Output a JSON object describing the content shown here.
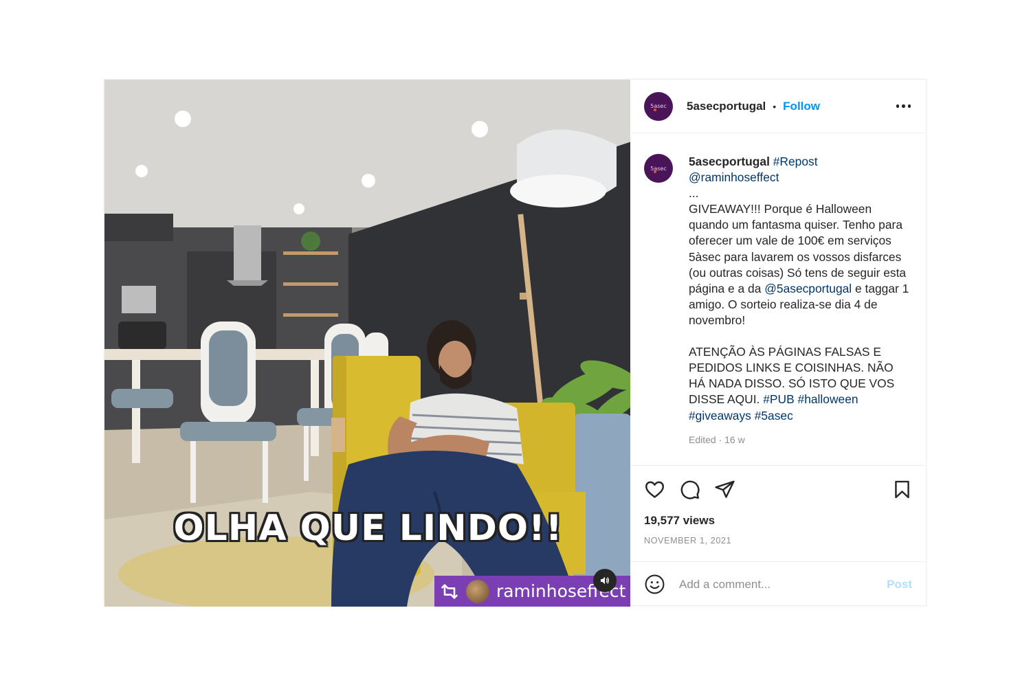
{
  "post": {
    "account": "5asecportugal",
    "separator": "•",
    "follow_label": "Follow",
    "avatar_logo_text": "5asec",
    "media": {
      "overlay_text": "OLHA QUE LINDO!!",
      "repost_username": "raminhoseffect"
    },
    "caption": {
      "username": "5asecportugal",
      "hashtag_repost": "#Repost",
      "mention_source": "@raminhoseffect",
      "ellipsis": "...",
      "text_1": "GIVEAWAY!!! Porque é Halloween quando um fantasma quiser. Tenho para oferecer um vale de 100€ em serviços 5àsec para lavarem os vossos disfarces (ou outras coisas) Só tens de seguir esta página e a da",
      "mention_2": "@5asecportugal",
      "text_2": "e taggar 1 amigo. O sorteio realiza-se dia 4 de novembro!",
      "text_3": "ATENÇÃO ÀS PÁGINAS FALSAS E PEDIDOS LINKS E COISINHAS. NÃO HÁ NADA DISSO. SÓ ISTO QUE VOS DISSE AQUI.",
      "hashtags": [
        "#PUB",
        "#halloween",
        "#giveaways",
        "#5asec"
      ],
      "edited": "Edited · 16 w"
    },
    "stats": {
      "views": "19,577 views",
      "date": "NOVEMBER 1, 2021"
    },
    "comment": {
      "placeholder": "Add a comment...",
      "post_label": "Post"
    },
    "icons": {
      "like": "heart-icon",
      "comment": "comment-bubble-icon",
      "share": "paper-plane-icon",
      "save": "bookmark-icon",
      "emoji": "emoji-smiley-icon",
      "sound": "speaker-icon",
      "repost": "repost-icon",
      "more": "more-options-icon"
    },
    "colors": {
      "follow": "#0095f6",
      "link": "#00376b",
      "post_disabled": "#b2dffc",
      "repost_tag": "#7b3fb3",
      "avatar": "#4a1458"
    }
  }
}
